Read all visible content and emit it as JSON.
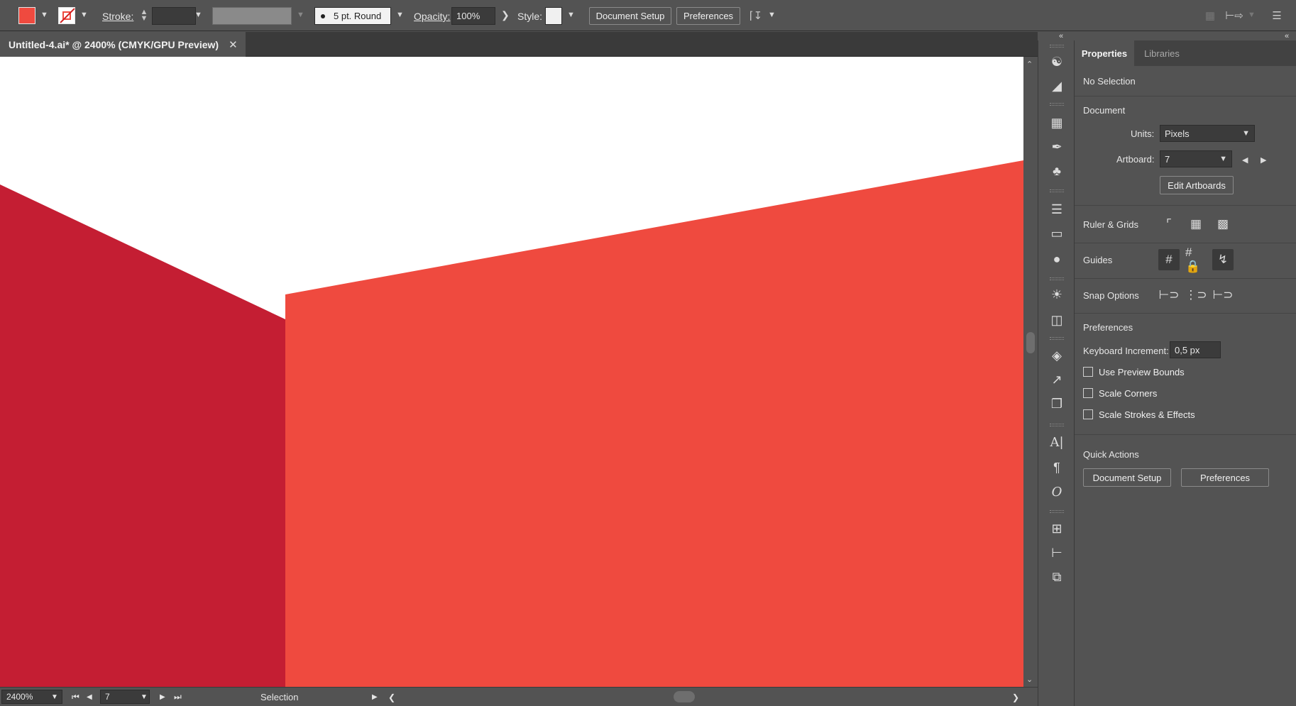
{
  "control_bar": {
    "stroke_label": "Stroke:",
    "brush_label": "5 pt. Round",
    "opacity_label": "Opacity:",
    "opacity_value": "100%",
    "style_label": "Style:",
    "document_setup": "Document Setup",
    "preferences": "Preferences",
    "fill_color": "#ef4a3f"
  },
  "document_tab": {
    "title": "Untitled-4.ai* @ 2400% (CMYK/GPU Preview)",
    "close": "✕"
  },
  "artwork": {
    "dark_red": "#c41e33",
    "red": "#ef4a3f",
    "background": "#ffffff"
  },
  "status_bar": {
    "zoom": "2400%",
    "artboard": "7",
    "tool": "Selection"
  },
  "panel": {
    "tabs": [
      "Properties",
      "Libraries"
    ],
    "selection": "No Selection",
    "document_heading": "Document",
    "units_label": "Units:",
    "units_value": "Pixels",
    "artboard_label": "Artboard:",
    "artboard_value": "7",
    "edit_artboards": "Edit Artboards",
    "ruler_grids": "Ruler & Grids",
    "guides": "Guides",
    "snap_options": "Snap Options",
    "preferences_heading": "Preferences",
    "keyboard_increment_label": "Keyboard Increment:",
    "keyboard_increment_value": "0,5 px",
    "checkboxes": [
      "Use Preview Bounds",
      "Scale Corners",
      "Scale Strokes & Effects"
    ],
    "quick_actions": "Quick Actions",
    "qa_document_setup": "Document Setup",
    "qa_preferences": "Preferences"
  }
}
